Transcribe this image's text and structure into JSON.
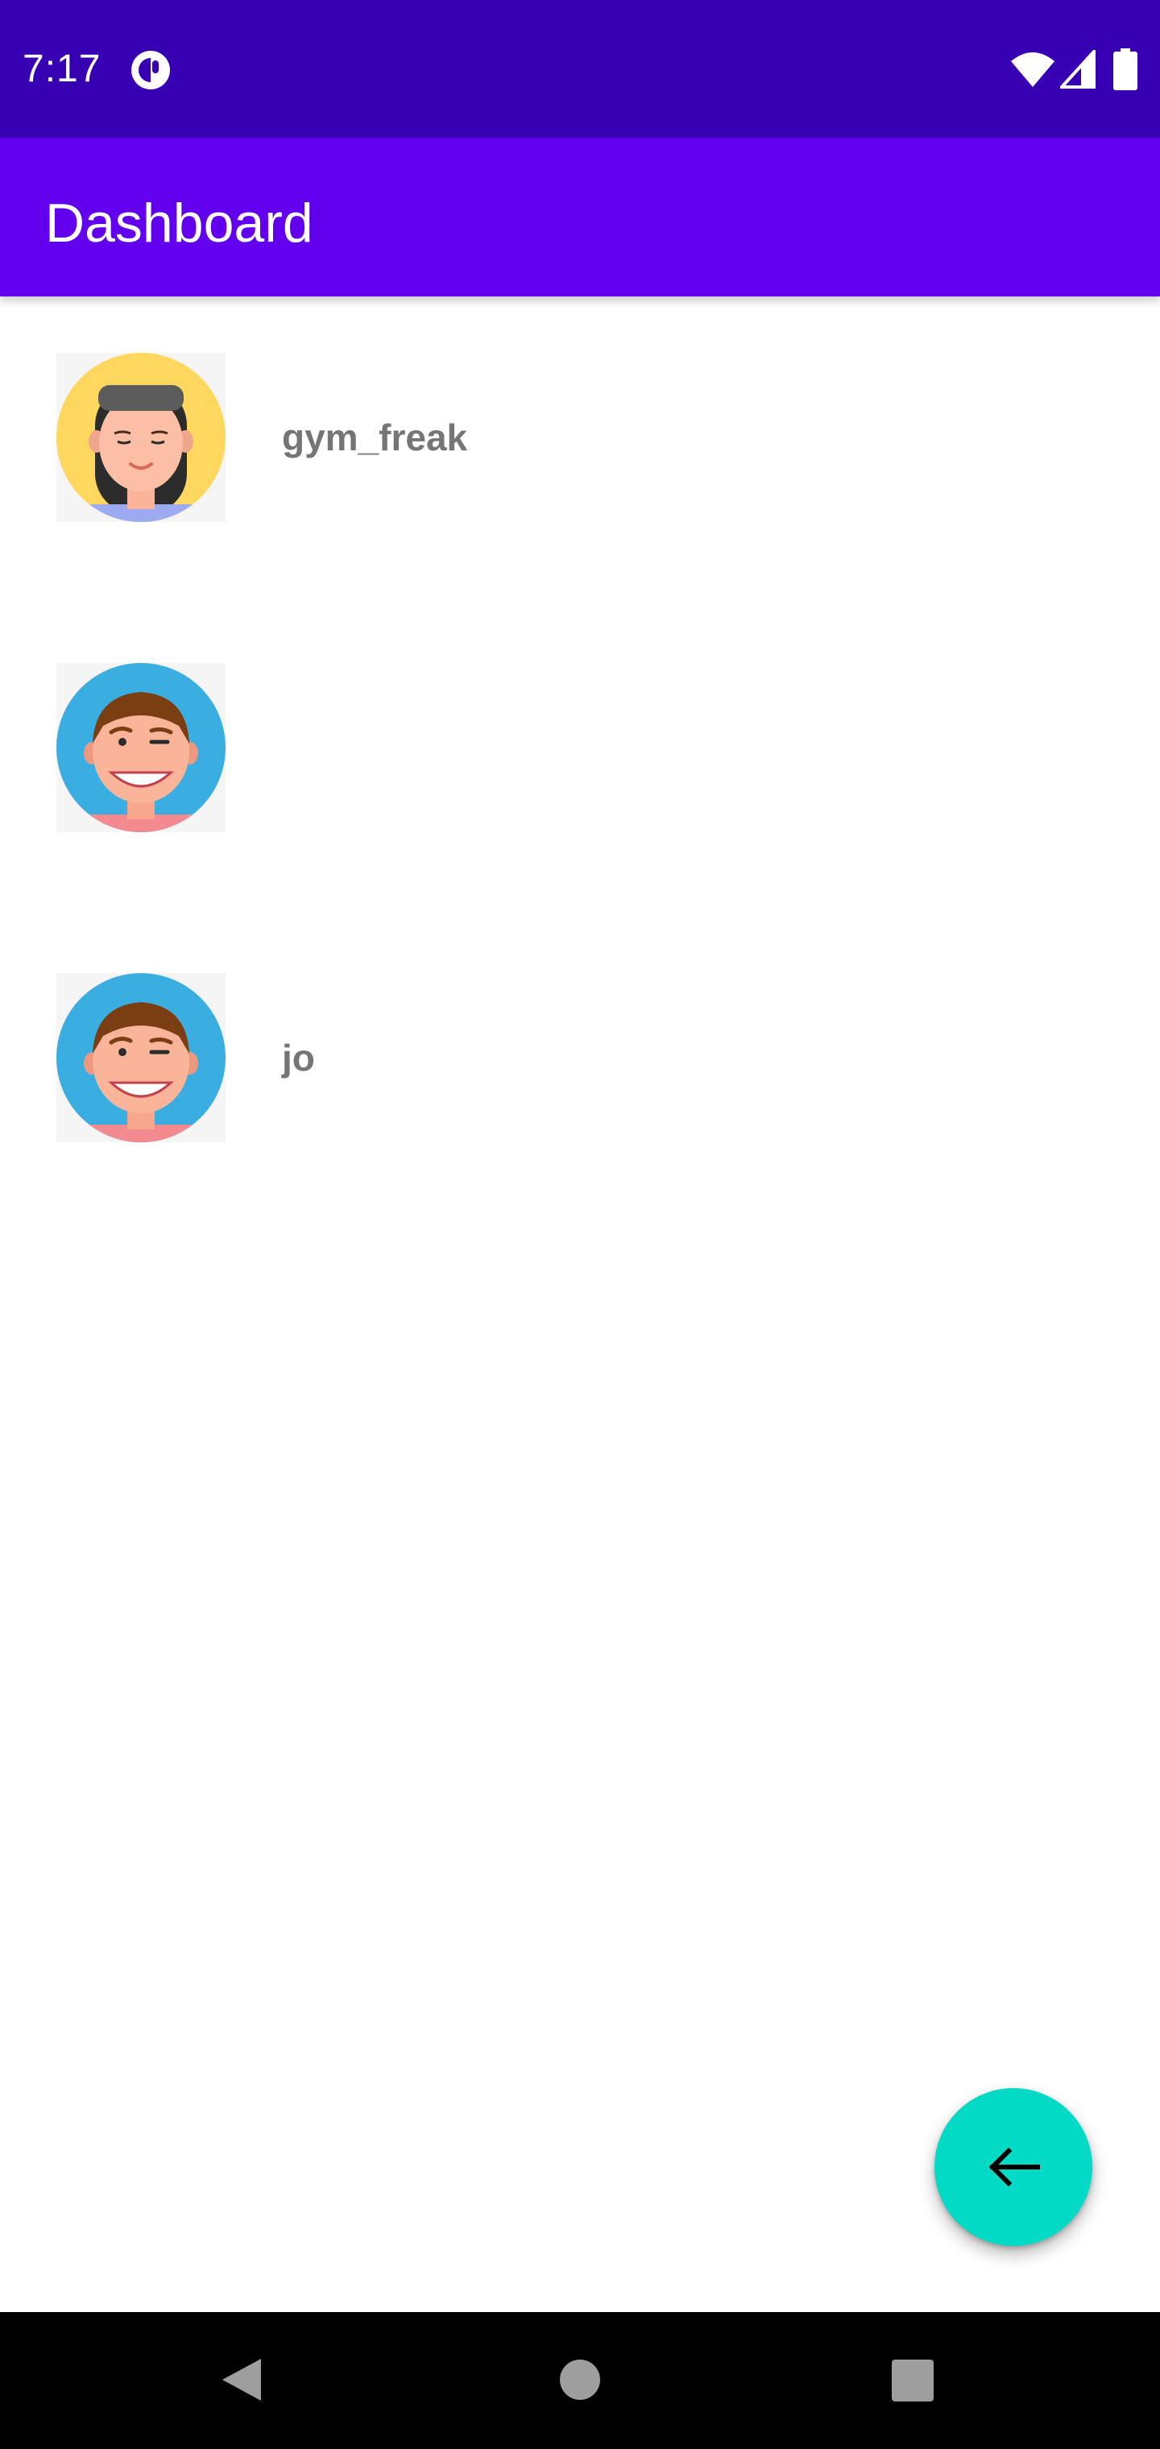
{
  "status_bar": {
    "time": "7:17",
    "icons": [
      "app-notification-icon",
      "wifi-icon",
      "cell-signal-icon",
      "battery-icon"
    ]
  },
  "app_bar": {
    "title": "Dashboard"
  },
  "users": [
    {
      "username": "gym_freak",
      "avatar": "female-avatar-icon"
    },
    {
      "username": "",
      "avatar": "male-avatar-icon"
    },
    {
      "username": "jo",
      "avatar": "male-avatar-icon"
    }
  ],
  "fab": {
    "icon": "arrow-back-icon"
  },
  "nav_bar": {
    "icons": [
      "nav-back-icon",
      "nav-home-icon",
      "nav-recents-icon"
    ]
  },
  "colors": {
    "status_bar": "#3700b3",
    "app_bar": "#6200ee",
    "fab": "#03dac5",
    "username_text": "#757575"
  }
}
